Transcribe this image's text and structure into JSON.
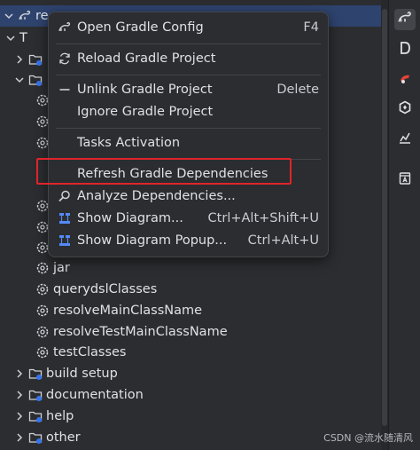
{
  "tree": {
    "root_label": "re",
    "group_1_label": "T",
    "tasks": [
      "jar",
      "querydslClasses",
      "resolveMainClassName",
      "resolveTestMainClassName",
      "testClasses"
    ],
    "groups": [
      "build setup",
      "documentation",
      "help",
      "other"
    ]
  },
  "menu": {
    "items": [
      {
        "label": "Open Gradle Config",
        "shortcut": "F4",
        "icon": "gradle-icon"
      },
      {
        "label": "Reload Gradle Project",
        "shortcut": "",
        "icon": "reload-icon"
      },
      {
        "label": "Unlink Gradle Project",
        "shortcut": "Delete",
        "icon": "minus-icon"
      },
      {
        "label": "Ignore Gradle Project",
        "shortcut": "",
        "icon": ""
      },
      {
        "label": "Tasks Activation",
        "shortcut": "",
        "icon": ""
      },
      {
        "label": "Refresh Gradle Dependencies",
        "shortcut": "",
        "icon": ""
      },
      {
        "label": "Analyze Dependencies...",
        "shortcut": "",
        "icon": "analyze-icon"
      },
      {
        "label": "Show Diagram...",
        "shortcut": "Ctrl+Alt+Shift+U",
        "icon": "diagram-icon"
      },
      {
        "label": "Show Diagram Popup...",
        "shortcut": "Ctrl+Alt+U",
        "icon": "diagram-icon"
      }
    ]
  },
  "right_toolbar": [
    "gradle-icon",
    "database-icon",
    "maven-icon",
    "ai-assistant-icon",
    "profiler-icon",
    "notifications-icon"
  ],
  "colors": {
    "accent": "#e0242b",
    "selection": "#2e436e",
    "background": "#2b2d30"
  },
  "watermark": "CSDN @流水随清风"
}
